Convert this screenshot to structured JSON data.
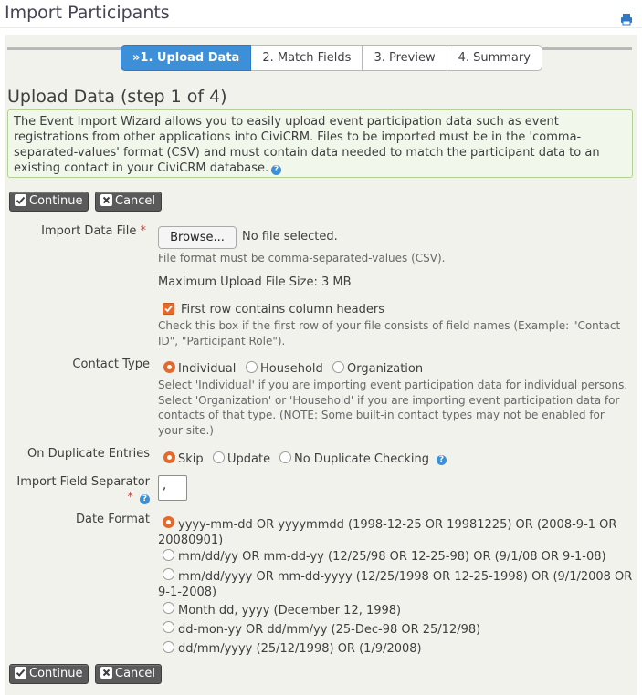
{
  "page": {
    "title": "Import Participants",
    "print_icon": "print-icon"
  },
  "wizard": {
    "steps": [
      {
        "label": "»1. Upload Data",
        "active": true
      },
      {
        "label": "2. Match Fields",
        "active": false
      },
      {
        "label": "3. Preview",
        "active": false
      },
      {
        "label": "4. Summary",
        "active": false
      }
    ]
  },
  "section": {
    "heading": "Upload Data (step 1 of 4)",
    "help_text": "The Event Import Wizard allows you to easily upload event participation data such as event registrations from other applications into CiviCRM. Files to be imported must be in the 'comma-separated-values' format (CSV) and must contain data needed to match the participant data to an existing contact in your CiviCRM database."
  },
  "buttons": {
    "continue_label": "Continue",
    "cancel_label": "Cancel"
  },
  "import_file": {
    "label": "Import Data File",
    "required_mark": "*",
    "browse_label": "Browse...",
    "file_status": "No file selected.",
    "format_note": "File format must be comma-separated-values (CSV).",
    "max_size": "Maximum Upload File Size: 3 MB"
  },
  "headers_checkbox": {
    "label": "First row contains column headers",
    "checked": true,
    "description": "Check this box if the first row of your file consists of field names (Example: \"Contact ID\", \"Participant Role\")."
  },
  "contact_type": {
    "label": "Contact Type",
    "options": [
      {
        "label": "Individual",
        "selected": true
      },
      {
        "label": "Household",
        "selected": false
      },
      {
        "label": "Organization",
        "selected": false
      }
    ],
    "description": "Select 'Individual' if you are importing event participation data for individual persons. Select 'Organization' or 'Household' if you are importing event participation data for contacts of that type. (NOTE: Some built-in contact types may not be enabled for your site.)"
  },
  "duplicates": {
    "label": "On Duplicate Entries",
    "options": [
      {
        "label": "Skip",
        "selected": true
      },
      {
        "label": "Update",
        "selected": false
      },
      {
        "label": "No Duplicate Checking",
        "selected": false
      }
    ]
  },
  "separator": {
    "label": "Import Field Separator",
    "required_mark": "*",
    "value": ","
  },
  "date_format": {
    "label": "Date Format",
    "options": [
      {
        "label": "yyyy-mm-dd OR yyyymmdd (1998-12-25 OR 19981225) OR (2008-9-1 OR 20080901)",
        "selected": true
      },
      {
        "label": "mm/dd/yy OR mm-dd-yy (12/25/98 OR 12-25-98) OR (9/1/08 OR 9-1-08)",
        "selected": false
      },
      {
        "label": "mm/dd/yyyy OR mm-dd-yyyy (12/25/1998 OR 12-25-1998) OR (9/1/2008 OR 9-1-2008)",
        "selected": false
      },
      {
        "label": "Month dd, yyyy (December 12, 1998)",
        "selected": false
      },
      {
        "label": "dd-mon-yy OR dd/mm/yy (25-Dec-98 OR 25/12/98)",
        "selected": false
      },
      {
        "label": "dd/mm/yyyy (25/12/1998) OR (1/9/2008)",
        "selected": false
      }
    ]
  },
  "colors": {
    "accent": "#3d8fd8",
    "radio_selected": "#e36a2a",
    "button_dark": "#5a5a5a",
    "help_background": "#f1f8eb"
  }
}
